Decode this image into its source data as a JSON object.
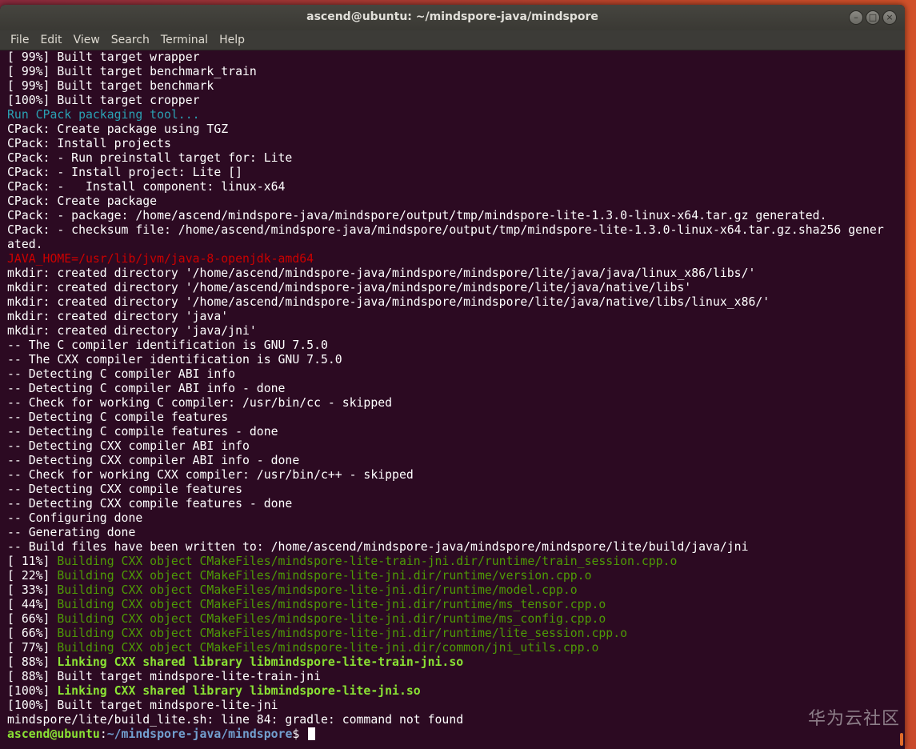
{
  "window": {
    "title": "ascend@ubuntu: ~/mindspore-java/mindspore",
    "buttons": {
      "minimize": "–",
      "maximize": "□",
      "close": "×"
    }
  },
  "menubar": [
    "File",
    "Edit",
    "View",
    "Search",
    "Terminal",
    "Help"
  ],
  "terminal": {
    "lines": [
      {
        "style": "default",
        "text": "[ 99%] Built target wrapper"
      },
      {
        "style": "default",
        "text": "[ 99%] Built target benchmark_train"
      },
      {
        "style": "default",
        "text": "[ 99%] Built target benchmark"
      },
      {
        "style": "default",
        "text": "[100%] Built target cropper"
      },
      {
        "style": "cyan",
        "text": "Run CPack packaging tool..."
      },
      {
        "style": "default",
        "text": "CPack: Create package using TGZ"
      },
      {
        "style": "default",
        "text": "CPack: Install projects"
      },
      {
        "style": "default",
        "text": "CPack: - Run preinstall target for: Lite"
      },
      {
        "style": "default",
        "text": "CPack: - Install project: Lite []"
      },
      {
        "style": "default",
        "text": "CPack: -   Install component: linux-x64"
      },
      {
        "style": "default",
        "text": "CPack: Create package"
      },
      {
        "style": "default",
        "text": "CPack: - package: /home/ascend/mindspore-java/mindspore/output/tmp/mindspore-lite-1.3.0-linux-x64.tar.gz generated."
      },
      {
        "style": "default",
        "text": "CPack: - checksum file: /home/ascend/mindspore-java/mindspore/output/tmp/mindspore-lite-1.3.0-linux-x64.tar.gz.sha256 gener"
      },
      {
        "style": "default",
        "text": "ated."
      },
      {
        "style": "red",
        "text": "JAVA_HOME=/usr/lib/jvm/java-8-openjdk-amd64"
      },
      {
        "style": "default",
        "text": "mkdir: created directory '/home/ascend/mindspore-java/mindspore/mindspore/lite/java/java/linux_x86/libs/'"
      },
      {
        "style": "default",
        "text": "mkdir: created directory '/home/ascend/mindspore-java/mindspore/mindspore/lite/java/native/libs'"
      },
      {
        "style": "default",
        "text": "mkdir: created directory '/home/ascend/mindspore-java/mindspore/mindspore/lite/java/native/libs/linux_x86/'"
      },
      {
        "style": "default",
        "text": "mkdir: created directory 'java'"
      },
      {
        "style": "default",
        "text": "mkdir: created directory 'java/jni'"
      },
      {
        "style": "default",
        "text": "-- The C compiler identification is GNU 7.5.0"
      },
      {
        "style": "default",
        "text": "-- The CXX compiler identification is GNU 7.5.0"
      },
      {
        "style": "default",
        "text": "-- Detecting C compiler ABI info"
      },
      {
        "style": "default",
        "text": "-- Detecting C compiler ABI info - done"
      },
      {
        "style": "default",
        "text": "-- Check for working C compiler: /usr/bin/cc - skipped"
      },
      {
        "style": "default",
        "text": "-- Detecting C compile features"
      },
      {
        "style": "default",
        "text": "-- Detecting C compile features - done"
      },
      {
        "style": "default",
        "text": "-- Detecting CXX compiler ABI info"
      },
      {
        "style": "default",
        "text": "-- Detecting CXX compiler ABI info - done"
      },
      {
        "style": "default",
        "text": "-- Check for working CXX compiler: /usr/bin/c++ - skipped"
      },
      {
        "style": "default",
        "text": "-- Detecting CXX compile features"
      },
      {
        "style": "default",
        "text": "-- Detecting CXX compile features - done"
      },
      {
        "style": "default",
        "text": "-- Configuring done"
      },
      {
        "style": "default",
        "text": "-- Generating done"
      },
      {
        "style": "default",
        "text": "-- Build files have been written to: /home/ascend/mindspore-java/mindspore/mindspore/lite/build/java/jni"
      },
      {
        "style": "split",
        "prefix": "[ 11%] ",
        "style2": "green",
        "text": "Building CXX object CMakeFiles/mindspore-lite-train-jni.dir/runtime/train_session.cpp.o"
      },
      {
        "style": "split",
        "prefix": "[ 22%] ",
        "style2": "green",
        "text": "Building CXX object CMakeFiles/mindspore-lite-jni.dir/runtime/version.cpp.o"
      },
      {
        "style": "split",
        "prefix": "[ 33%] ",
        "style2": "green",
        "text": "Building CXX object CMakeFiles/mindspore-lite-jni.dir/runtime/model.cpp.o"
      },
      {
        "style": "split",
        "prefix": "[ 44%] ",
        "style2": "green",
        "text": "Building CXX object CMakeFiles/mindspore-lite-jni.dir/runtime/ms_tensor.cpp.o"
      },
      {
        "style": "split",
        "prefix": "[ 66%] ",
        "style2": "green",
        "text": "Building CXX object CMakeFiles/mindspore-lite-jni.dir/runtime/ms_config.cpp.o"
      },
      {
        "style": "split",
        "prefix": "[ 66%] ",
        "style2": "green",
        "text": "Building CXX object CMakeFiles/mindspore-lite-jni.dir/runtime/lite_session.cpp.o"
      },
      {
        "style": "split",
        "prefix": "[ 77%] ",
        "style2": "green",
        "text": "Building CXX object CMakeFiles/mindspore-lite-jni.dir/common/jni_utils.cpp.o"
      },
      {
        "style": "split",
        "prefix": "[ 88%] ",
        "style2": "bgreen",
        "text": "Linking CXX shared library libmindspore-lite-train-jni.so"
      },
      {
        "style": "default",
        "text": "[ 88%] Built target mindspore-lite-train-jni"
      },
      {
        "style": "split",
        "prefix": "[100%] ",
        "style2": "bgreen",
        "text": "Linking CXX shared library libmindspore-lite-jni.so"
      },
      {
        "style": "default",
        "text": "[100%] Built target mindspore-lite-jni"
      },
      {
        "style": "default",
        "text": "mindspore/lite/build_lite.sh: line 84: gradle: command not found"
      }
    ],
    "prompt": {
      "user": "ascend@ubuntu",
      "sep": ":",
      "path": "~/mindspore-java/mindspore",
      "symbol": "$ "
    }
  },
  "watermark": "华为云社区"
}
